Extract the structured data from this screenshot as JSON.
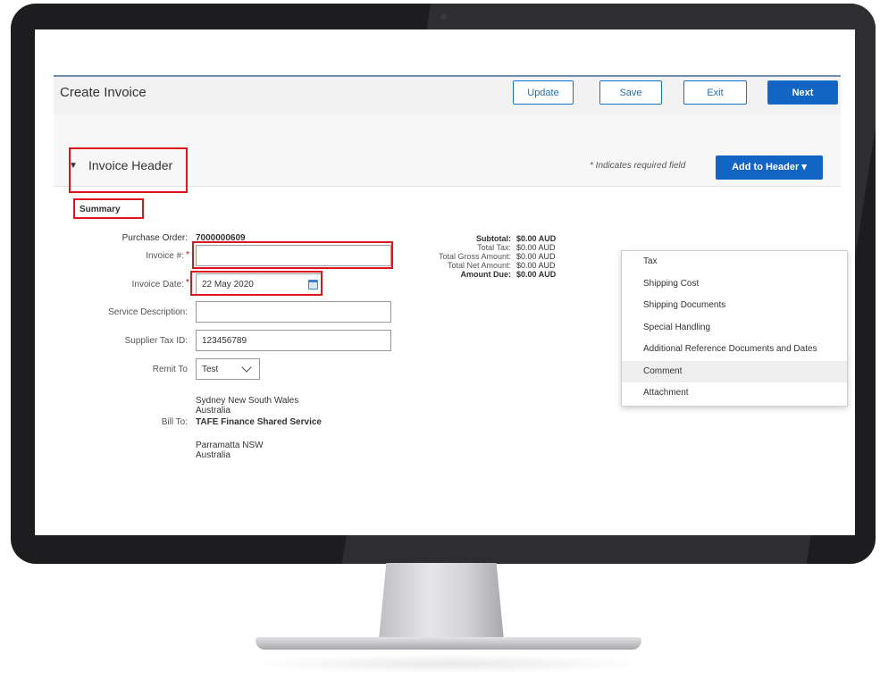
{
  "toolbar": {
    "title": "Create Invoice",
    "update": "Update",
    "save": "Save",
    "exit": "Exit",
    "next": "Next"
  },
  "section": {
    "toggle": "▼",
    "title": "Invoice Header",
    "required_note": "* Indicates required field",
    "add_to_header": "Add to Header ▾"
  },
  "summary_tab": "Summary",
  "form": {
    "po_label": "Purchase Order:",
    "po_value": "7000000609",
    "invoice_no_label": "Invoice #:",
    "invoice_no_value": "",
    "invoice_date_label": "Invoice Date:",
    "invoice_date_value": "22 May 2020",
    "service_desc_label": "Service Description:",
    "service_desc_value": "",
    "supplier_tax_label": "Supplier Tax ID:",
    "supplier_tax_value": "123456789",
    "remit_label": "Remit To",
    "remit_value": "Test",
    "remit_addr1": "Sydney New South Wales",
    "remit_addr2": "Australia",
    "bill_label": "Bill To:",
    "bill_value": "TAFE Finance Shared Service",
    "bill_addr1": "Parramatta NSW",
    "bill_addr2": "Australia",
    "required_mark": "*"
  },
  "totals": {
    "subtotal_label": "Subtotal:",
    "subtotal_value": "$0.00 AUD",
    "tax_label": "Total Tax:",
    "tax_value": "$0.00 AUD",
    "gross_label": "Total Gross Amount:",
    "gross_value": "$0.00 AUD",
    "net_label": "Total Net Amount:",
    "net_value": "$0.00 AUD",
    "due_label": "Amount Due:",
    "due_value": "$0.00 AUD"
  },
  "menu": [
    {
      "label": "Tax"
    },
    {
      "label": "Shipping Cost"
    },
    {
      "label": "Shipping Documents"
    },
    {
      "label": "Special Handling"
    },
    {
      "label": "Additional Reference Documents and Dates"
    },
    {
      "label": "Comment"
    },
    {
      "label": "Attachment"
    }
  ],
  "colors": {
    "primary": "#1265c2",
    "highlight": "#e0141e",
    "bezel": "#1d1d1f"
  },
  "icons": {
    "calendar": "calendar-icon",
    "dropdown": "chevron-down-icon"
  }
}
